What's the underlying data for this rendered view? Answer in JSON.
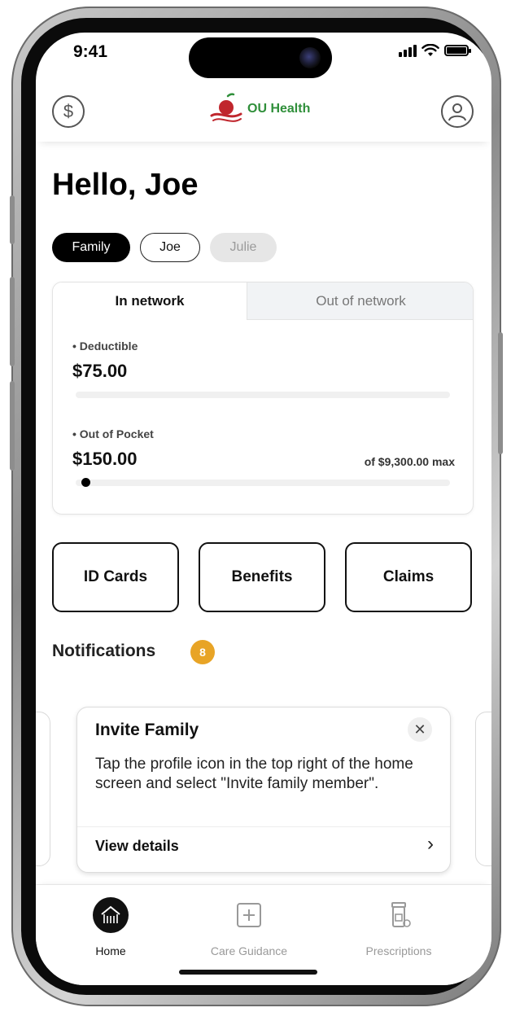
{
  "status_bar": {
    "time": "9:41"
  },
  "header": {
    "brand": "OU Health",
    "left_icon": "dollar-icon",
    "right_icon": "profile-icon"
  },
  "greeting": "Hello, Joe",
  "members": {
    "family": "Family",
    "joe": "Joe",
    "julie": "Julie",
    "selected": "Family"
  },
  "coverage": {
    "tab_in": "In network",
    "tab_out": "Out of network",
    "selected_tab": "In network",
    "deductible_label": "• Deductible",
    "deductible_amount": "$75.00",
    "out_of_pocket_label": "• Out of Pocket",
    "out_of_pocket_amount": "$150.00",
    "out_of_pocket_max": "of $9,300.00 max",
    "out_of_pocket_progress": 0.016
  },
  "quick_actions": {
    "id_cards": "ID Cards",
    "benefits": "Benefits",
    "claims": "Claims"
  },
  "notifications": {
    "title": "Notifications",
    "count": "8",
    "card": {
      "title": "Invite Family",
      "body": "Tap the profile icon in the top right of the home screen and select \"Invite family member\".",
      "link": "View details"
    },
    "page_index": 6,
    "page_count": 8
  },
  "tab_bar": {
    "home": "Home",
    "care_guidance": "Care Guidance",
    "prescriptions": "Prescriptions",
    "selected": "Home"
  },
  "colors": {
    "brand_green": "#2f8f3a",
    "brand_red": "#c0262d",
    "badge": "#e8a426"
  }
}
